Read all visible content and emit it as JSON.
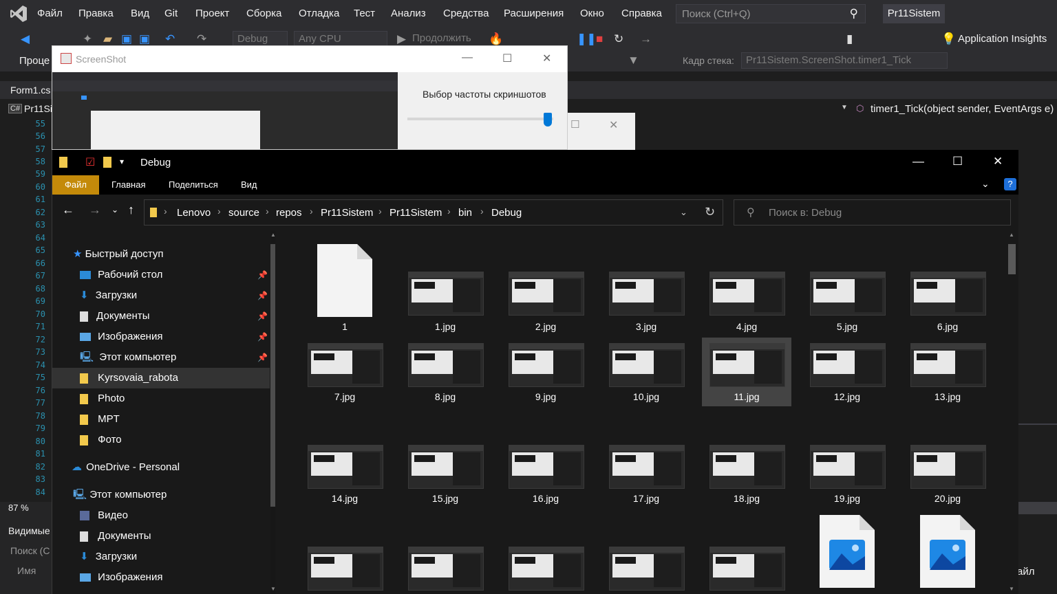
{
  "vs": {
    "menu": [
      "Файл",
      "Правка",
      "Вид",
      "Git",
      "Проект",
      "Сборка",
      "Отладка",
      "Тест",
      "Анализ",
      "Средства",
      "Расширения",
      "Окно",
      "Справка"
    ],
    "search_placeholder": "Поиск (Ctrl+Q)",
    "project_name": "Pr11Sistem",
    "config": "Debug",
    "platform": "Any CPU",
    "continue_label": "Продолжить",
    "app_insights": "Application Insights",
    "process_label": "Проце",
    "stack_label": "Кадр стека:",
    "stack_value": "Pr11Sistem.ScreenShot.timer1_Tick",
    "tab_form": "Form1.cs",
    "tab_project_short": "Pr11Si",
    "member": "timer1_Tick(object sender, EventArgs e)",
    "line_numbers": [
      "55",
      "56",
      "57",
      "58",
      "59",
      "60",
      "61",
      "62",
      "63",
      "64",
      "65",
      "66",
      "67",
      "68",
      "69",
      "70",
      "71",
      "72",
      "73",
      "74",
      "75",
      "76",
      "77",
      "78",
      "79",
      "80",
      "81",
      "82",
      "83",
      "84"
    ],
    "zoom": "87 %",
    "bottom_visible": "Видимые",
    "bottom_search": "Поиск (С",
    "bottom_name": "Имя",
    "right_partial": "айл"
  },
  "screenshot_window": {
    "title": "ScreenShot",
    "freq_label": "Выбор частоты скриншотов",
    "slider_value": 1.0
  },
  "explorer": {
    "title": "Debug",
    "ribbon": [
      "Файл",
      "Главная",
      "Поделиться",
      "Вид"
    ],
    "path": [
      "Lenovo",
      "source",
      "repos",
      "Pr11Sistem",
      "Pr11Sistem",
      "bin",
      "Debug"
    ],
    "search_placeholder": "Поиск в: Debug",
    "nav": {
      "quick_access": "Быстрый доступ",
      "pinned": [
        "Рабочий стол",
        "Загрузки",
        "Документы",
        "Изображения",
        "Этот компьютер"
      ],
      "folders": [
        "Kyrsovaia_rabota",
        "Photo",
        "MPT",
        "Фото"
      ],
      "onedrive": "OneDrive - Personal",
      "this_pc": "Этот компьютер",
      "pc_items": [
        "Видео",
        "Документы",
        "Загрузки",
        "Изображения"
      ]
    },
    "files": {
      "row1": [
        "1",
        "1.jpg",
        "2.jpg",
        "3.jpg",
        "4.jpg",
        "5.jpg",
        "6.jpg"
      ],
      "row2": [
        "7.jpg",
        "8.jpg",
        "9.jpg",
        "10.jpg",
        "11.jpg",
        "12.jpg",
        "13.jpg"
      ],
      "row3": [
        "14.jpg",
        "15.jpg",
        "16.jpg",
        "17.jpg",
        "18.jpg",
        "19.jpg",
        "20.jpg"
      ]
    },
    "selected_file": "11.jpg"
  }
}
